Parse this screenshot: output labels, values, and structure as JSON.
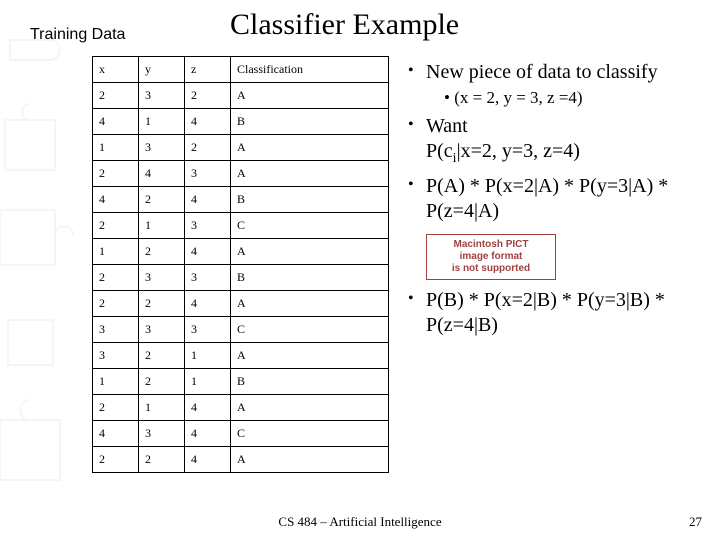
{
  "title": "Classifier Example",
  "section_label": "Training Data",
  "table": {
    "headers": [
      "x",
      "y",
      "z",
      "Classification"
    ],
    "rows": [
      [
        "2",
        "3",
        "2",
        "A"
      ],
      [
        "4",
        "1",
        "4",
        "B"
      ],
      [
        "1",
        "3",
        "2",
        "A"
      ],
      [
        "2",
        "4",
        "3",
        "A"
      ],
      [
        "4",
        "2",
        "4",
        "B"
      ],
      [
        "2",
        "1",
        "3",
        "C"
      ],
      [
        "1",
        "2",
        "4",
        "A"
      ],
      [
        "2",
        "3",
        "3",
        "B"
      ],
      [
        "2",
        "2",
        "4",
        "A"
      ],
      [
        "3",
        "3",
        "3",
        "C"
      ],
      [
        "3",
        "2",
        "1",
        "A"
      ],
      [
        "1",
        "2",
        "1",
        "B"
      ],
      [
        "2",
        "1",
        "4",
        "A"
      ],
      [
        "4",
        "3",
        "4",
        "C"
      ],
      [
        "2",
        "2",
        "4",
        "A"
      ]
    ]
  },
  "bullets": {
    "b1": "New piece of data to classify",
    "b1_sub": "(x = 2, y = 3, z =4)",
    "b2_line1": "Want",
    "b2_line2_prefix": "P(c",
    "b2_line2_sub": "i",
    "b2_line2_suffix": "|x=2, y=3, z=4)",
    "b3": "P(A) * P(x=2|A) * P(y=3|A) * P(z=4|A)",
    "b4": "P(B) * P(x=2|B) * P(y=3|B) * P(z=4|B)"
  },
  "placeholder": {
    "line1": "Macintosh PICT",
    "line2": "image format",
    "line3": "is not supported"
  },
  "footer": "CS 484 – Artificial Intelligence",
  "slide_number": "27"
}
